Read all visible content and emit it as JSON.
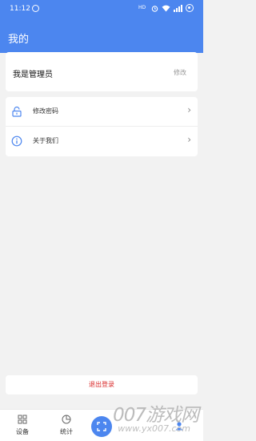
{
  "status_bar": {
    "time": "11:12",
    "network": "HD"
  },
  "header": {
    "title": "我的"
  },
  "profile": {
    "name": "我是管理员",
    "edit_label": "修改"
  },
  "menu": [
    {
      "label": "修改密码",
      "icon": "lock-icon"
    },
    {
      "label": "关于我们",
      "icon": "info-icon"
    }
  ],
  "logout": {
    "label": "退出登录"
  },
  "tabbar": {
    "items": [
      {
        "label": "设备",
        "icon": "grid-icon"
      },
      {
        "label": "统计",
        "icon": "pie-chart-icon"
      },
      {
        "label": "",
        "icon": "scan-icon"
      },
      {
        "label": "",
        "icon": "user-icon"
      }
    ]
  },
  "watermark": {
    "text": "007游戏网",
    "url": "www.yx007.com"
  },
  "colors": {
    "primary": "#4c86ef",
    "danger": "#d92b2b",
    "background": "#f2f2f2"
  }
}
